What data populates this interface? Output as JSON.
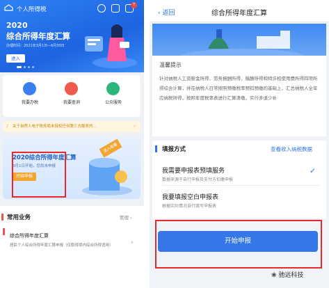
{
  "left": {
    "app_title": "个人所得税",
    "badge": "7",
    "hero_year": "2020",
    "hero_title": "综合所得年度汇算",
    "hero_period": "办理时间：2021年3月1日—6月30日",
    "enter_label": "进入",
    "services": [
      "我要办税",
      "我要查询",
      "公众服务"
    ],
    "notice": "关于自然人电子税务局未授权任何第三方服务的...",
    "banner_title": "2020综合所得年度汇算",
    "banner_subtitle": "3月1日开始，您尚未申报",
    "banner_button": "开始申报",
    "banner_tag": "进入看看",
    "common_title": "常用业务",
    "manage_label": "管理",
    "row_title": "综合所得年度汇算",
    "row_desc": "居民个人综合所得年度汇算申报（仅取得境内综合所得适用）"
  },
  "right": {
    "back_label": "返回",
    "title": "综合所得年度汇算",
    "tips_heading": "温馨提示",
    "tips_text": "针对纳税人工资薪金所得、劳务报酬所得、稿酬所得和特许权使用费所得四项所得综合计算，并在纳税人日常按照预缴税率预扣预缴的基础上，汇总纳税人全年应纳税所得，按照年度税率表进行汇算清缴，实行多退少补",
    "mode_heading": "填报方式",
    "mode_link": "查看收入纳税数据",
    "option1_title": "我需要申报表预填服务",
    "option1_desc": "数据来源于自行申报及支付方扣缴申报",
    "option2_title": "我要填报空白申报表",
    "option2_desc": "根据实际情况自行填写申报表",
    "start_button": "开始申报"
  },
  "watermark": "驰远科技",
  "colors": {
    "primary": "#2b73e6",
    "highlight_box": "#e8282a",
    "warn": "#f2a531"
  }
}
